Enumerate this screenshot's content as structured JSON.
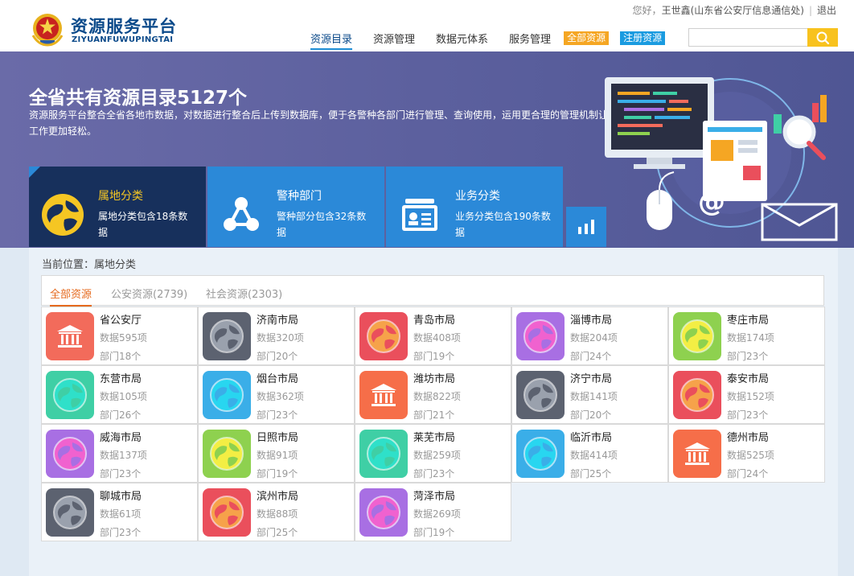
{
  "header": {
    "brand_title": "资源服务平台",
    "brand_sub": "ZIYUANFUWUPINGTAI",
    "greeting": "您好，",
    "user": "王世鑫(山东省公安厅信息通信处)",
    "logout": "退出"
  },
  "nav": {
    "items": [
      {
        "label": "资源目录",
        "active": true
      },
      {
        "label": "资源管理",
        "active": false
      },
      {
        "label": "数据元体系",
        "active": false
      },
      {
        "label": "服务管理",
        "active": false
      }
    ],
    "btn_all": "全部资源",
    "btn_register": "注册资源",
    "search_placeholder": ""
  },
  "banner": {
    "title": "全省共有资源目录5127个",
    "desc": "资源服务平台整合全省各地市数据，对数据进行整合后上传到数据库，便于各警种各部门进行管理、查询使用，运用更合理的管理机制让工作更加轻松。"
  },
  "categories": [
    {
      "name": "属地分类",
      "desc": "属地分类包含18条数据"
    },
    {
      "name": "警种部门",
      "desc": "警种部分包含32条数据"
    },
    {
      "name": "业务分类",
      "desc": "业务分类包含190条数据"
    }
  ],
  "breadcrumb": "当前位置：属地分类",
  "tabs": [
    {
      "label": "全部资源"
    },
    {
      "label": "公安资源(2739)"
    },
    {
      "label": "社会资源(2303)"
    }
  ],
  "colors": {
    "red": "#f26b5b",
    "gray": "#5c6270",
    "rose": "#ea4f5c",
    "purple": "#a86fe3",
    "lime": "#8ed14f",
    "mint": "#3fcfa5",
    "sky": "#3aaee8",
    "orange": "#f66e49"
  },
  "tiles": [
    {
      "name": "省公安厅",
      "data": "数据595项",
      "dept": "部门18个",
      "color": "#f26b5b",
      "icon": "bank-icon",
      "inner": "#f7d774"
    },
    {
      "name": "济南市局",
      "data": "数据320项",
      "dept": "部门20个",
      "color": "#5c6270",
      "icon": "globe-icon",
      "inner": "#9aa1ad"
    },
    {
      "name": "青岛市局",
      "data": "数据408项",
      "dept": "部门19个",
      "color": "#ea4f5c",
      "icon": "globe-icon",
      "inner": "#f6a24a"
    },
    {
      "name": "淄博市局",
      "data": "数据204项",
      "dept": "部门24个",
      "color": "#a86fe3",
      "icon": "globe-icon",
      "inner": "#f062cf"
    },
    {
      "name": "枣庄市局",
      "data": "数据174项",
      "dept": "部门23个",
      "color": "#8ed14f",
      "icon": "globe-icon",
      "inner": "#f3ee44"
    },
    {
      "name": "东营市局",
      "data": "数据105项",
      "dept": "部门26个",
      "color": "#3fcfa5",
      "icon": "globe-icon",
      "inner": "#2fe0c9"
    },
    {
      "name": "烟台市局",
      "data": "数据362项",
      "dept": "部门23个",
      "color": "#3aaee8",
      "icon": "globe-icon",
      "inner": "#28d6f0"
    },
    {
      "name": "潍坊市局",
      "data": "数据822项",
      "dept": "部门21个",
      "color": "#f66e49",
      "icon": "bank-icon",
      "inner": "#f7c65a"
    },
    {
      "name": "济宁市局",
      "data": "数据141项",
      "dept": "部门20个",
      "color": "#5c6270",
      "icon": "globe-icon",
      "inner": "#9aa1ad"
    },
    {
      "name": "泰安市局",
      "data": "数据152项",
      "dept": "部门23个",
      "color": "#ea4f5c",
      "icon": "globe-icon",
      "inner": "#f6a24a"
    },
    {
      "name": "威海市局",
      "data": "数据137项",
      "dept": "部门23个",
      "color": "#a86fe3",
      "icon": "globe-icon",
      "inner": "#f062cf"
    },
    {
      "name": "日照市局",
      "data": "数据91项",
      "dept": "部门19个",
      "color": "#8ed14f",
      "icon": "globe-icon",
      "inner": "#f3ee44"
    },
    {
      "name": "莱芜市局",
      "data": "数据259项",
      "dept": "部门23个",
      "color": "#3fcfa5",
      "icon": "globe-icon",
      "inner": "#2fe0c9"
    },
    {
      "name": "临沂市局",
      "data": "数据414项",
      "dept": "部门25个",
      "color": "#3aaee8",
      "icon": "globe-icon",
      "inner": "#28d6f0"
    },
    {
      "name": "德州市局",
      "data": "数据525项",
      "dept": "部门24个",
      "color": "#f66e49",
      "icon": "bank-icon",
      "inner": "#f7c65a"
    },
    {
      "name": "聊城市局",
      "data": "数据61项",
      "dept": "部门23个",
      "color": "#5c6270",
      "icon": "globe-icon",
      "inner": "#9aa1ad"
    },
    {
      "name": "滨州市局",
      "data": "数据88项",
      "dept": "部门25个",
      "color": "#ea4f5c",
      "icon": "globe-icon",
      "inner": "#f6a24a"
    },
    {
      "name": "菏泽市局",
      "data": "数据269项",
      "dept": "部门19个",
      "color": "#a86fe3",
      "icon": "globe-icon",
      "inner": "#f062cf"
    }
  ]
}
